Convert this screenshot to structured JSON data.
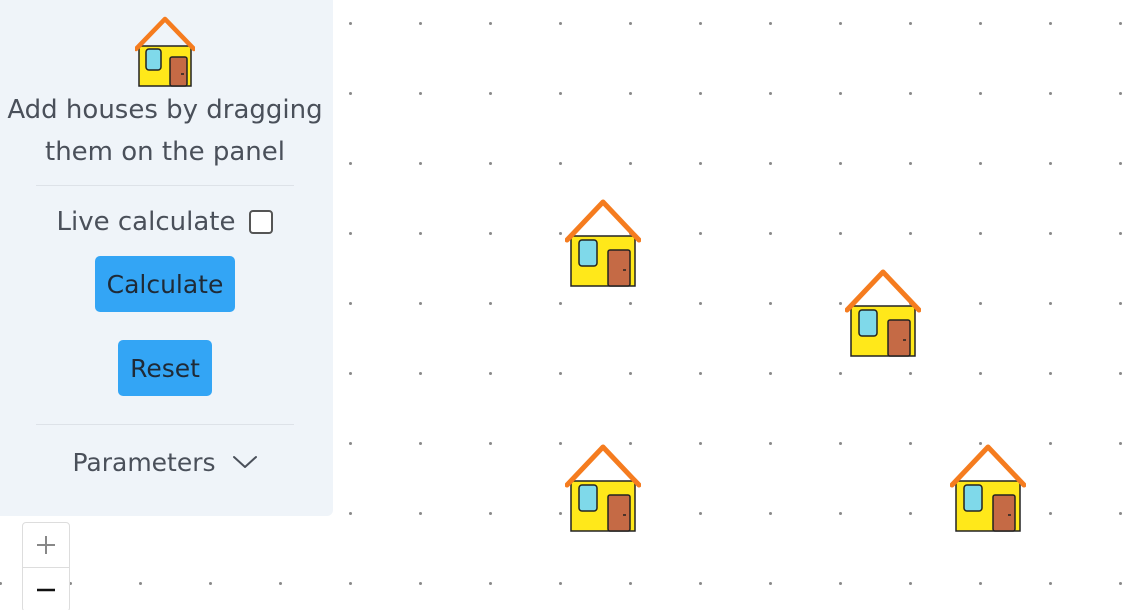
{
  "panel": {
    "hint_line1": "Add houses by dragging",
    "hint_line2": "them on the panel",
    "live_calculate_label": "Live calculate",
    "live_calculate_checked": false,
    "calculate_label": "Calculate",
    "reset_label": "Reset",
    "parameters_label": "Parameters",
    "button_color": "#33a5f5",
    "background_color": "#eff4f9"
  },
  "zoom": {
    "zoom_in_icon": "plus-icon",
    "zoom_out_icon": "minus-icon"
  },
  "canvas": {
    "house_icon": "house-icon",
    "house_count": 4,
    "background_color": "#ffffff",
    "grid_dot_color": "#8a8a8a"
  }
}
